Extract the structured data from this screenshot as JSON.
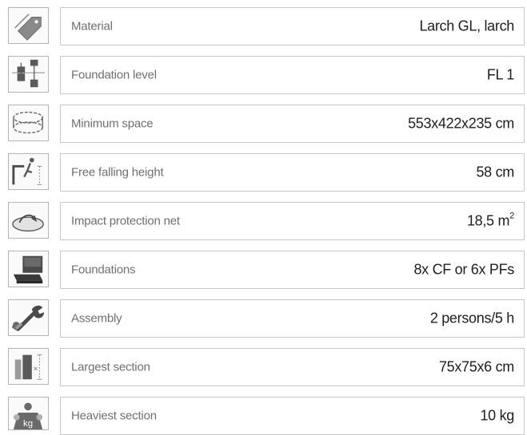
{
  "specs": [
    {
      "icon": "price-tag-icon",
      "label": "Material",
      "value": "Larch GL, larch"
    },
    {
      "icon": "foundation-level-icon",
      "label": "Foundation level",
      "value": "FL 1"
    },
    {
      "icon": "minimum-space-icon",
      "label": "Minimum space",
      "value": "553x422x235 cm"
    },
    {
      "icon": "falling-height-icon",
      "label": "Free falling height",
      "value": "58 cm"
    },
    {
      "icon": "impact-net-icon",
      "label": "Impact protection net",
      "value": "18,5 m",
      "value_sup": "2"
    },
    {
      "icon": "foundations-icon",
      "label": "Foundations",
      "value": "8x CF or 6x PFs"
    },
    {
      "icon": "assembly-wrench-icon",
      "label": "Assembly",
      "value": "2 persons/5 h"
    },
    {
      "icon": "largest-section-icon",
      "label": "Largest section",
      "value": "75x75x6 cm"
    },
    {
      "icon": "weight-kg-icon",
      "label": "Heaviest section",
      "value": "10 kg",
      "icon_text": "kg"
    }
  ]
}
